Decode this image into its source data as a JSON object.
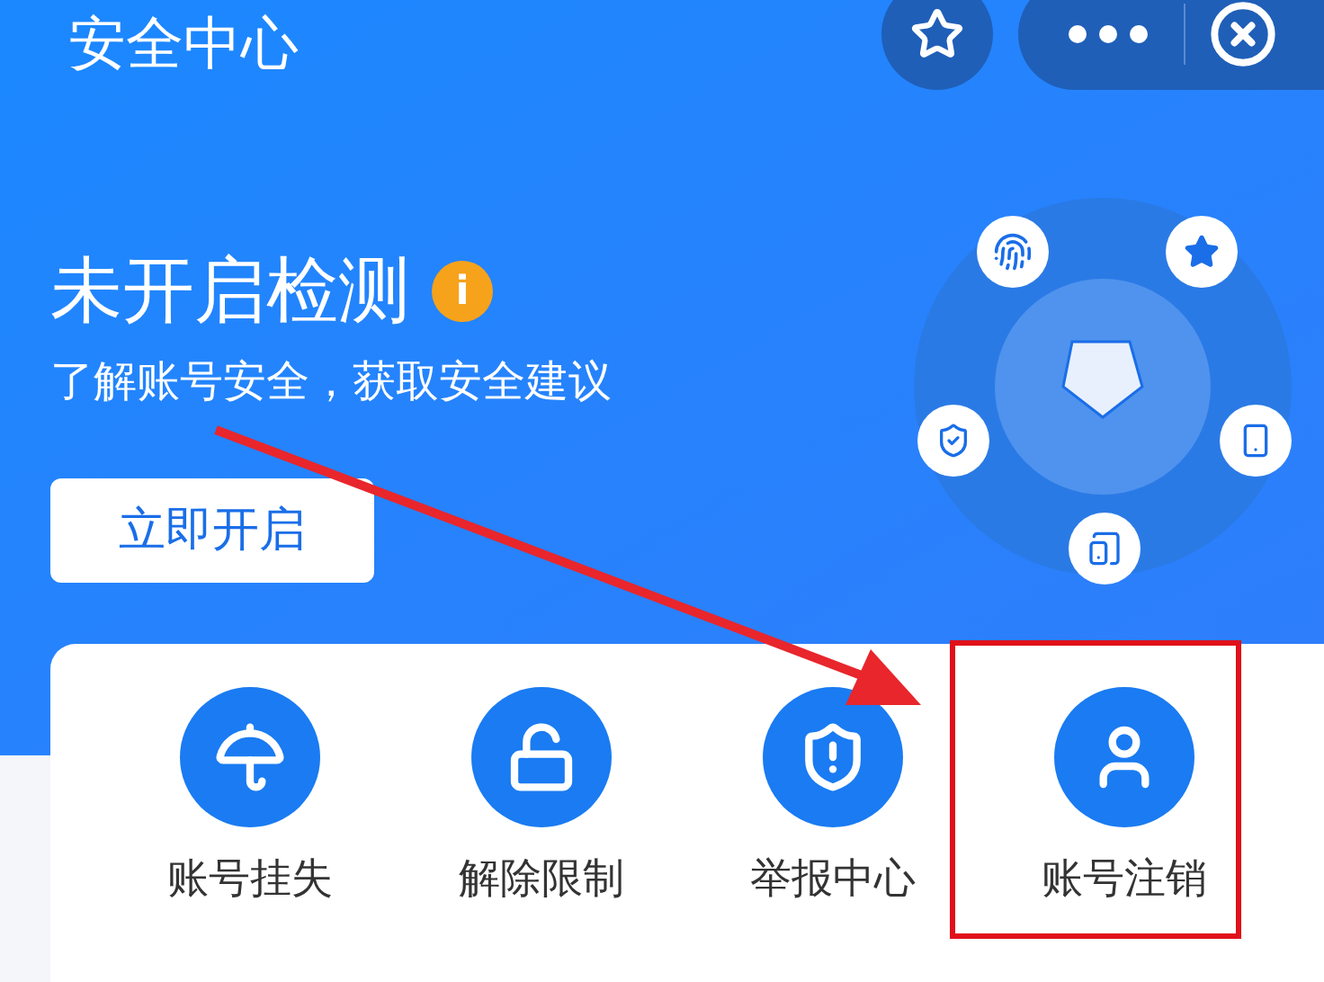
{
  "header": {
    "title": "安全中心"
  },
  "hero": {
    "heading": "未开启检测",
    "info_badge": "i",
    "subtitle": "了解账号安全，获取安全建议",
    "button": "立即开启"
  },
  "actions": [
    {
      "label": "账号挂失",
      "kind": "umbrella",
      "highlighted": false
    },
    {
      "label": "解除限制",
      "kind": "unlock",
      "highlighted": false
    },
    {
      "label": "举报中心",
      "kind": "report",
      "highlighted": false
    },
    {
      "label": "账号注销",
      "kind": "user",
      "highlighted": true
    }
  ]
}
